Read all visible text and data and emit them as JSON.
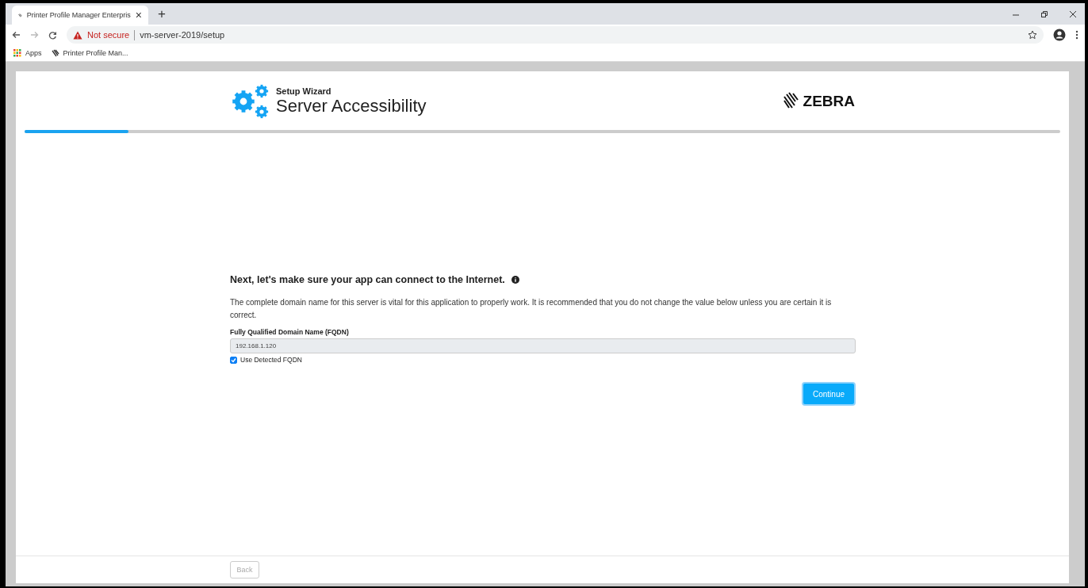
{
  "browser": {
    "tab": {
      "title": "Printer Profile Manager Enterpris",
      "close": "×"
    },
    "new_tab": "+",
    "security": "Not secure",
    "url": "vm-server-2019/setup",
    "bookmarks": [
      {
        "label": "Apps",
        "kind": "apps"
      },
      {
        "label": "Printer Profile Man...",
        "kind": "site"
      }
    ]
  },
  "header": {
    "subtitle": "Setup Wizard",
    "title": "Server Accessibility",
    "brand": "ZEBRA"
  },
  "progress": {
    "level": 0.1
  },
  "content": {
    "heading": "Next, let's make sure your app can connect to the Internet.",
    "description": "The complete domain name for this server is vital for this application to properly work. It is recommended that you do not change the value below unless you are certain it is correct.",
    "field": {
      "label": "Fully Qualified Domain Name (FQDN)",
      "value": "192.168.1.120",
      "disabled": true
    },
    "checkbox": {
      "label": "Use Detected FQDN",
      "checked": true
    },
    "continue": "Continue"
  },
  "footer": {
    "back": {
      "label": "Back",
      "disabled": true
    }
  }
}
